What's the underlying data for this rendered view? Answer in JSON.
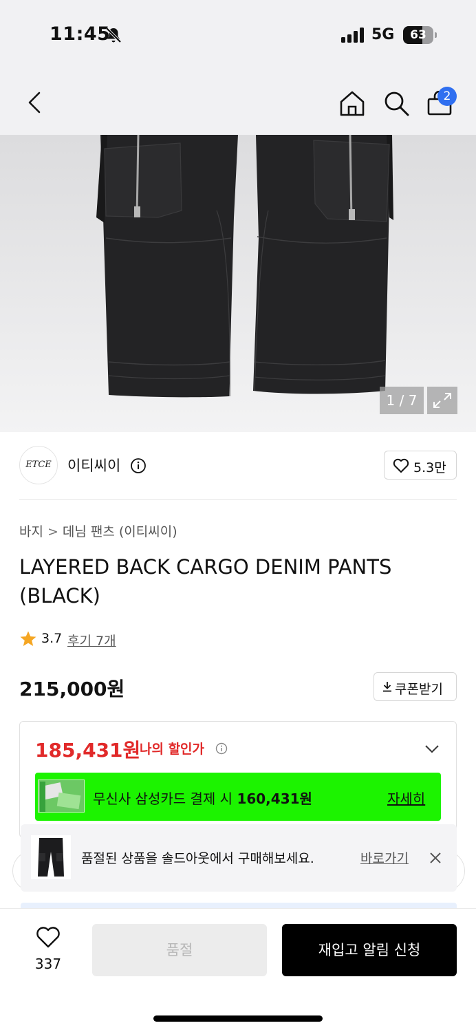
{
  "status_bar": {
    "time": "11:45",
    "network": "5G",
    "battery": "63",
    "battery_level": 0.63
  },
  "nav": {
    "cart_count": "2"
  },
  "gallery": {
    "counter": "1 / 7"
  },
  "brand": {
    "logo_text": "ETCE",
    "name": "이티씨이",
    "likes": "5.3만"
  },
  "breadcrumb": {
    "category": "바지",
    "separator": ">",
    "subcategory": "데님 팬츠 (이티씨이)"
  },
  "product": {
    "title": "LAYERED BACK CARGO DENIM PANTS (BLACK)",
    "rating": "3.7",
    "reviews": "후기 7개",
    "price": "215,000원",
    "coupon_label": "쿠폰받기"
  },
  "discount": {
    "my_price": "185,431원",
    "my_price_label": "나의 할인가",
    "card_text": "무신사 삼성카드 결제 시 ",
    "card_price": "160,431원",
    "card_detail": "자세히"
  },
  "toast": {
    "message": "품절된 상품을 솔드아웃에서 구매해보세요.",
    "link": "바로가기"
  },
  "bottom": {
    "wish_count": "337",
    "soldout_label": "품절",
    "restock_label": "재입고 알림 신청"
  },
  "colors": {
    "accent_red": "#e12a2a",
    "banner_green": "#1cf300",
    "badge_blue": "#2f6ff0"
  }
}
